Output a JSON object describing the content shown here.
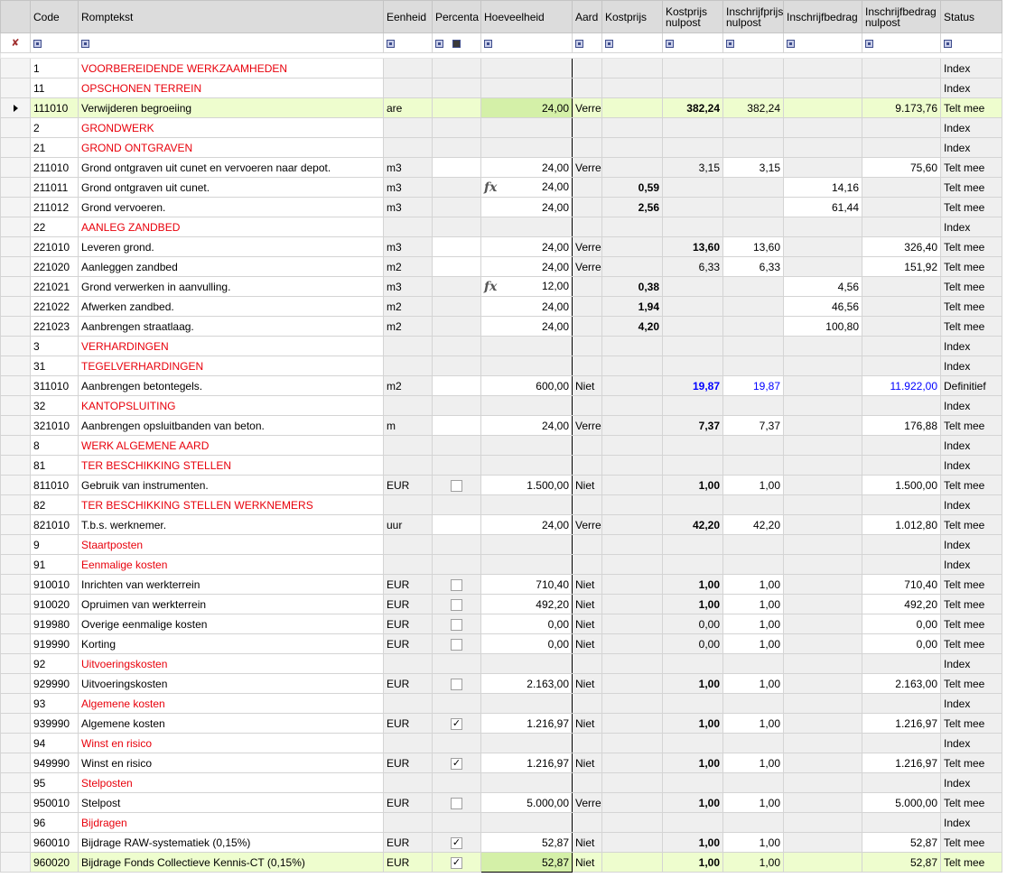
{
  "columns": {
    "code": "Code",
    "romptekst": "Romptekst",
    "eenheid": "Eenheid",
    "percentage": "Percenta",
    "hoeveelheid": "Hoeveelheid",
    "aard": "Aard",
    "kostprijs": "Kostprijs",
    "kostprijs_nulpost_1": "Kostprijs",
    "kostprijs_nulpost_2": "nulpost",
    "inschrijfprijs_nulpost_1": "Inschrijfprijs",
    "inschrijfprijs_nulpost_2": "nulpost",
    "inschrijfbedrag": "Inschrijfbedrag",
    "inschrijfbedrag_nulpost_1": "Inschrijfbedrag",
    "inschrijfbedrag_nulpost_2": "nulpost",
    "status": "Status"
  },
  "icons": {
    "pin": "pin-icon",
    "row_indicator": "row-pointer-icon",
    "filter": "filter-icon",
    "formula": "fx",
    "check": "✓"
  },
  "colors": {
    "header_bg": "#dcdcdc",
    "group_text": "#e8000b",
    "selected_row": "#eefdce",
    "definitive_text": "#0000ff"
  },
  "rows": [
    {
      "code": "1",
      "text": "VOORBEREIDENDE WERKZAAMHEDEN",
      "unit": "",
      "pct": "",
      "qty": "",
      "aard": "",
      "kp": "",
      "kpn": "",
      "ipn": "",
      "ib": "",
      "ibn": "",
      "status": "Index",
      "type": "group"
    },
    {
      "code": "11",
      "text": "OPSCHONEN TERREIN",
      "unit": "",
      "pct": "",
      "qty": "",
      "aard": "",
      "kp": "",
      "kpn": "",
      "ipn": "",
      "ib": "",
      "ibn": "",
      "status": "Index",
      "type": "group"
    },
    {
      "code": "111010",
      "text": "Verwijderen begroeiing",
      "unit": "are",
      "pct": "",
      "qty": "24,00",
      "aard": "Verre",
      "kp": "",
      "kpn": "382,24",
      "ipn": "382,24",
      "ib": "",
      "ibn": "9.173,76",
      "status": "Telt mee",
      "type": "item",
      "selected": true
    },
    {
      "code": "2",
      "text": "GRONDWERK",
      "unit": "",
      "pct": "",
      "qty": "",
      "aard": "",
      "kp": "",
      "kpn": "",
      "ipn": "",
      "ib": "",
      "ibn": "",
      "status": "Index",
      "type": "group"
    },
    {
      "code": "21",
      "text": "GROND ONTGRAVEN",
      "unit": "",
      "pct": "",
      "qty": "",
      "aard": "",
      "kp": "",
      "kpn": "",
      "ipn": "",
      "ib": "",
      "ibn": "",
      "status": "Index",
      "type": "group"
    },
    {
      "code": "211010",
      "text": "Grond ontgraven uit cunet en vervoeren naar depot.",
      "unit": "m3",
      "pct": "",
      "qty": "24,00",
      "aard": "Verre",
      "kp": "",
      "kpn": "3,15",
      "ipn": "3,15",
      "ib": "",
      "ibn": "75,60",
      "status": "Telt mee",
      "type": "item",
      "kpnbold": false
    },
    {
      "code": "211011",
      "text": "Grond ontgraven uit cunet.",
      "unit": "m3",
      "pct": "",
      "qty": "24,00",
      "fx": true,
      "aard": "",
      "kp": "0,59",
      "kpn": "",
      "ipn": "",
      "ib": "14,16",
      "ibn": "",
      "status": "Telt mee",
      "type": "sub"
    },
    {
      "code": "211012",
      "text": "Grond vervoeren.",
      "unit": "m3",
      "pct": "",
      "qty": "24,00",
      "aard": "",
      "kp": "2,56",
      "kpn": "",
      "ipn": "",
      "ib": "61,44",
      "ibn": "",
      "status": "Telt mee",
      "type": "sub"
    },
    {
      "code": "22",
      "text": "AANLEG ZANDBED",
      "unit": "",
      "pct": "",
      "qty": "",
      "aard": "",
      "kp": "",
      "kpn": "",
      "ipn": "",
      "ib": "",
      "ibn": "",
      "status": "Index",
      "type": "group"
    },
    {
      "code": "221010",
      "text": "Leveren grond.",
      "unit": "m3",
      "pct": "",
      "qty": "24,00",
      "aard": "Verre",
      "kp": "",
      "kpn": "13,60",
      "ipn": "13,60",
      "ib": "",
      "ibn": "326,40",
      "status": "Telt mee",
      "type": "item"
    },
    {
      "code": "221020",
      "text": "Aanleggen zandbed",
      "unit": "m2",
      "pct": "",
      "qty": "24,00",
      "aard": "Verre",
      "kp": "",
      "kpn": "6,33",
      "ipn": "6,33",
      "ib": "",
      "ibn": "151,92",
      "status": "Telt mee",
      "type": "item",
      "kpnbold": false
    },
    {
      "code": "221021",
      "text": "Grond verwerken in aanvulling.",
      "unit": "m3",
      "pct": "",
      "qty": "12,00",
      "fx": true,
      "aard": "",
      "kp": "0,38",
      "kpn": "",
      "ipn": "",
      "ib": "4,56",
      "ibn": "",
      "status": "Telt mee",
      "type": "sub"
    },
    {
      "code": "221022",
      "text": "Afwerken zandbed.",
      "unit": "m2",
      "pct": "",
      "qty": "24,00",
      "aard": "",
      "kp": "1,94",
      "kpn": "",
      "ipn": "",
      "ib": "46,56",
      "ibn": "",
      "status": "Telt mee",
      "type": "sub"
    },
    {
      "code": "221023",
      "text": "Aanbrengen straatlaag.",
      "unit": "m2",
      "pct": "",
      "qty": "24,00",
      "aard": "",
      "kp": "4,20",
      "kpn": "",
      "ipn": "",
      "ib": "100,80",
      "ibn": "",
      "status": "Telt mee",
      "type": "sub"
    },
    {
      "code": "3",
      "text": "VERHARDINGEN",
      "unit": "",
      "pct": "",
      "qty": "",
      "aard": "",
      "kp": "",
      "kpn": "",
      "ipn": "",
      "ib": "",
      "ibn": "",
      "status": "Index",
      "type": "group"
    },
    {
      "code": "31",
      "text": "TEGELVERHARDINGEN",
      "unit": "",
      "pct": "",
      "qty": "",
      "aard": "",
      "kp": "",
      "kpn": "",
      "ipn": "",
      "ib": "",
      "ibn": "",
      "status": "Index",
      "type": "group"
    },
    {
      "code": "311010",
      "text": "Aanbrengen betontegels.",
      "unit": "m2",
      "pct": "",
      "qty": "600,00",
      "aard": "Niet",
      "kp": "",
      "kpn": "19,87",
      "ipn": "19,87",
      "ib": "",
      "ibn": "11.922,00",
      "status": "Definitief",
      "type": "def"
    },
    {
      "code": "32",
      "text": "KANTOPSLUITING",
      "unit": "",
      "pct": "",
      "qty": "",
      "aard": "",
      "kp": "",
      "kpn": "",
      "ipn": "",
      "ib": "",
      "ibn": "",
      "status": "Index",
      "type": "group"
    },
    {
      "code": "321010",
      "text": "Aanbrengen opsluitbanden van beton.",
      "unit": "m",
      "pct": "",
      "qty": "24,00",
      "aard": "Verre",
      "kp": "",
      "kpn": "7,37",
      "ipn": "7,37",
      "ib": "",
      "ibn": "176,88",
      "status": "Telt mee",
      "type": "item"
    },
    {
      "code": "8",
      "text": "WERK ALGEMENE AARD",
      "unit": "",
      "pct": "",
      "qty": "",
      "aard": "",
      "kp": "",
      "kpn": "",
      "ipn": "",
      "ib": "",
      "ibn": "",
      "status": "Index",
      "type": "group"
    },
    {
      "code": "81",
      "text": "TER BESCHIKKING STELLEN",
      "unit": "",
      "pct": "",
      "qty": "",
      "aard": "",
      "kp": "",
      "kpn": "",
      "ipn": "",
      "ib": "",
      "ibn": "",
      "status": "Index",
      "type": "group"
    },
    {
      "code": "811010",
      "text": "Gebruik van instrumenten.",
      "unit": "EUR",
      "pct": "box",
      "qty": "1.500,00",
      "aard": "Niet",
      "kp": "",
      "kpn": "1,00",
      "ipn": "1,00",
      "ib": "",
      "ibn": "1.500,00",
      "status": "Telt mee",
      "type": "item"
    },
    {
      "code": "82",
      "text": "TER BESCHIKKING STELLEN WERKNEMERS",
      "unit": "",
      "pct": "",
      "qty": "",
      "aard": "",
      "kp": "",
      "kpn": "",
      "ipn": "",
      "ib": "",
      "ibn": "",
      "status": "Index",
      "type": "group"
    },
    {
      "code": "821010",
      "text": "T.b.s. werknemer.",
      "unit": "uur",
      "pct": "",
      "qty": "24,00",
      "aard": "Verre",
      "kp": "",
      "kpn": "42,20",
      "ipn": "42,20",
      "ib": "",
      "ibn": "1.012,80",
      "status": "Telt mee",
      "type": "item"
    },
    {
      "code": "9",
      "text": "Staartposten",
      "unit": "",
      "pct": "",
      "qty": "",
      "aard": "",
      "kp": "",
      "kpn": "",
      "ipn": "",
      "ib": "",
      "ibn": "",
      "status": "Index",
      "type": "group"
    },
    {
      "code": "91",
      "text": "Eenmalige kosten",
      "unit": "",
      "pct": "",
      "qty": "",
      "aard": "",
      "kp": "",
      "kpn": "",
      "ipn": "",
      "ib": "",
      "ibn": "",
      "status": "Index",
      "type": "group"
    },
    {
      "code": "910010",
      "text": "Inrichten van werkterrein",
      "unit": "EUR",
      "pct": "box",
      "qty": "710,40",
      "aard": "Niet",
      "kp": "",
      "kpn": "1,00",
      "ipn": "1,00",
      "ib": "",
      "ibn": "710,40",
      "status": "Telt mee",
      "type": "item"
    },
    {
      "code": "910020",
      "text": "Opruimen van werkterrein",
      "unit": "EUR",
      "pct": "box",
      "qty": "492,20",
      "aard": "Niet",
      "kp": "",
      "kpn": "1,00",
      "ipn": "1,00",
      "ib": "",
      "ibn": "492,20",
      "status": "Telt mee",
      "type": "item"
    },
    {
      "code": "919980",
      "text": "Overige eenmalige kosten",
      "unit": "EUR",
      "pct": "box",
      "qty": "0,00",
      "aard": "Niet",
      "kp": "",
      "kpn": "0,00",
      "ipn": "1,00",
      "ib": "",
      "ibn": "0,00",
      "status": "Telt mee",
      "type": "item",
      "kpnbold": false
    },
    {
      "code": "919990",
      "text": "Korting",
      "unit": "EUR",
      "pct": "box",
      "qty": "0,00",
      "aard": "Niet",
      "kp": "",
      "kpn": "0,00",
      "ipn": "1,00",
      "ib": "",
      "ibn": "0,00",
      "status": "Telt mee",
      "type": "item",
      "kpnbold": false
    },
    {
      "code": "92",
      "text": "Uitvoeringskosten",
      "unit": "",
      "pct": "",
      "qty": "",
      "aard": "",
      "kp": "",
      "kpn": "",
      "ipn": "",
      "ib": "",
      "ibn": "",
      "status": "Index",
      "type": "group"
    },
    {
      "code": "929990",
      "text": "Uitvoeringskosten",
      "unit": "EUR",
      "pct": "box",
      "qty": "2.163,00",
      "aard": "Niet",
      "kp": "",
      "kpn": "1,00",
      "ipn": "1,00",
      "ib": "",
      "ibn": "2.163,00",
      "status": "Telt mee",
      "type": "item"
    },
    {
      "code": "93",
      "text": "Algemene kosten",
      "unit": "",
      "pct": "",
      "qty": "",
      "aard": "",
      "kp": "",
      "kpn": "",
      "ipn": "",
      "ib": "",
      "ibn": "",
      "status": "Index",
      "type": "group"
    },
    {
      "code": "939990",
      "text": "Algemene kosten",
      "unit": "EUR",
      "pct": "check",
      "qty": "1.216,97",
      "aard": "Niet",
      "kp": "",
      "kpn": "1,00",
      "ipn": "1,00",
      "ib": "",
      "ibn": "1.216,97",
      "status": "Telt mee",
      "type": "item"
    },
    {
      "code": "94",
      "text": "Winst en risico",
      "unit": "",
      "pct": "",
      "qty": "",
      "aard": "",
      "kp": "",
      "kpn": "",
      "ipn": "",
      "ib": "",
      "ibn": "",
      "status": "Index",
      "type": "group"
    },
    {
      "code": "949990",
      "text": "Winst en risico",
      "unit": "EUR",
      "pct": "check",
      "qty": "1.216,97",
      "aard": "Niet",
      "kp": "",
      "kpn": "1,00",
      "ipn": "1,00",
      "ib": "",
      "ibn": "1.216,97",
      "status": "Telt mee",
      "type": "item"
    },
    {
      "code": "95",
      "text": "Stelposten",
      "unit": "",
      "pct": "",
      "qty": "",
      "aard": "",
      "kp": "",
      "kpn": "",
      "ipn": "",
      "ib": "",
      "ibn": "",
      "status": "Index",
      "type": "group"
    },
    {
      "code": "950010",
      "text": "Stelpost",
      "unit": "EUR",
      "pct": "box",
      "qty": "5.000,00",
      "aard": "Verre",
      "kp": "",
      "kpn": "1,00",
      "ipn": "1,00",
      "ib": "",
      "ibn": "5.000,00",
      "status": "Telt mee",
      "type": "item"
    },
    {
      "code": "96",
      "text": "Bijdragen",
      "unit": "",
      "pct": "",
      "qty": "",
      "aard": "",
      "kp": "",
      "kpn": "",
      "ipn": "",
      "ib": "",
      "ibn": "",
      "status": "Index",
      "type": "group"
    },
    {
      "code": "960010",
      "text": "Bijdrage RAW-systematiek (0,15%)",
      "unit": "EUR",
      "pct": "check",
      "qty": "52,87",
      "aard": "Niet",
      "kp": "",
      "kpn": "1,00",
      "ipn": "1,00",
      "ib": "",
      "ibn": "52,87",
      "status": "Telt mee",
      "type": "item"
    },
    {
      "code": "960020",
      "text": "Bijdrage Fonds Collectieve Kennis-CT (0,15%)",
      "unit": "EUR",
      "pct": "check",
      "qty": "52,87",
      "aard": "Niet",
      "kp": "",
      "kpn": "1,00",
      "ipn": "1,00",
      "ib": "",
      "ibn": "52,87",
      "status": "Telt mee",
      "type": "item",
      "highlight": true
    }
  ]
}
